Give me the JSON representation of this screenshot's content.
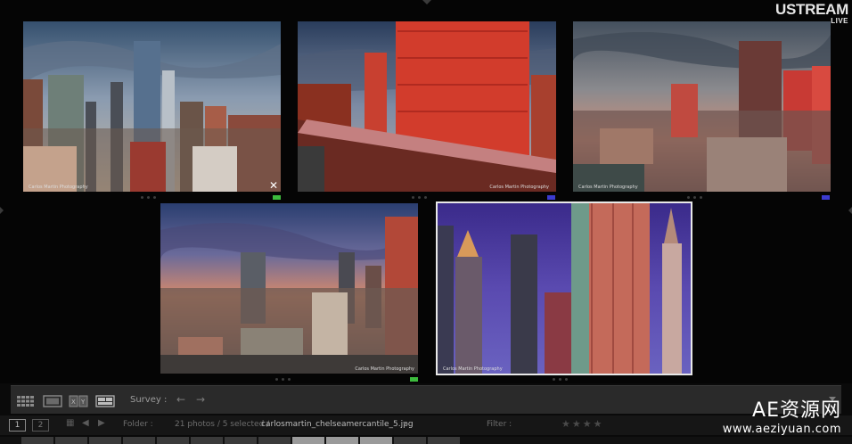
{
  "overlay": {
    "ustream_logo": "USTREAM",
    "ustream_live": "LIVE",
    "watermark_title": "AE资源网",
    "watermark_url": "www.aeziyuan.com"
  },
  "survey": {
    "photos": [
      {
        "id": "photo-1",
        "caption": "Carlos Martin Photography",
        "selected": false,
        "flag_color": "#3dbb3d",
        "has_close": true
      },
      {
        "id": "photo-2",
        "caption": "Carlos Martin Photography",
        "selected": false,
        "flag_color": "#3b3bd0",
        "has_close": false
      },
      {
        "id": "photo-3",
        "caption": "Carlos Martin Photography",
        "selected": false,
        "flag_color": "#3b3bd0",
        "has_close": false
      },
      {
        "id": "photo-4",
        "caption": "Carlos Martin Photography",
        "selected": false,
        "flag_color": "#3dbb3d",
        "has_close": false
      },
      {
        "id": "photo-5",
        "caption": "Carlos Martin Photography",
        "selected": true,
        "flag_color": "",
        "has_close": false
      }
    ]
  },
  "toolbar": {
    "icons": [
      "grid-view-icon",
      "loupe-view-icon",
      "compare-view-icon",
      "survey-view-icon"
    ],
    "view_label": "Survey :",
    "prev_arrow": "←",
    "next_arrow": "→"
  },
  "filmstrip": {
    "page1": "1",
    "page2": "2",
    "folder_label": "Folder :",
    "photo_count": "21 photos / 5 selected /",
    "filename": "carlosmartin_chelseamercantile_5.jpg",
    "filter_label": "Filter :",
    "stars": "★★★★"
  },
  "colors": {
    "background": "#050505",
    "toolbar": "#2a2a2a",
    "selection_border": "#e8e8e8",
    "flag_green": "#3dbb3d",
    "flag_blue": "#3b3bd0"
  }
}
